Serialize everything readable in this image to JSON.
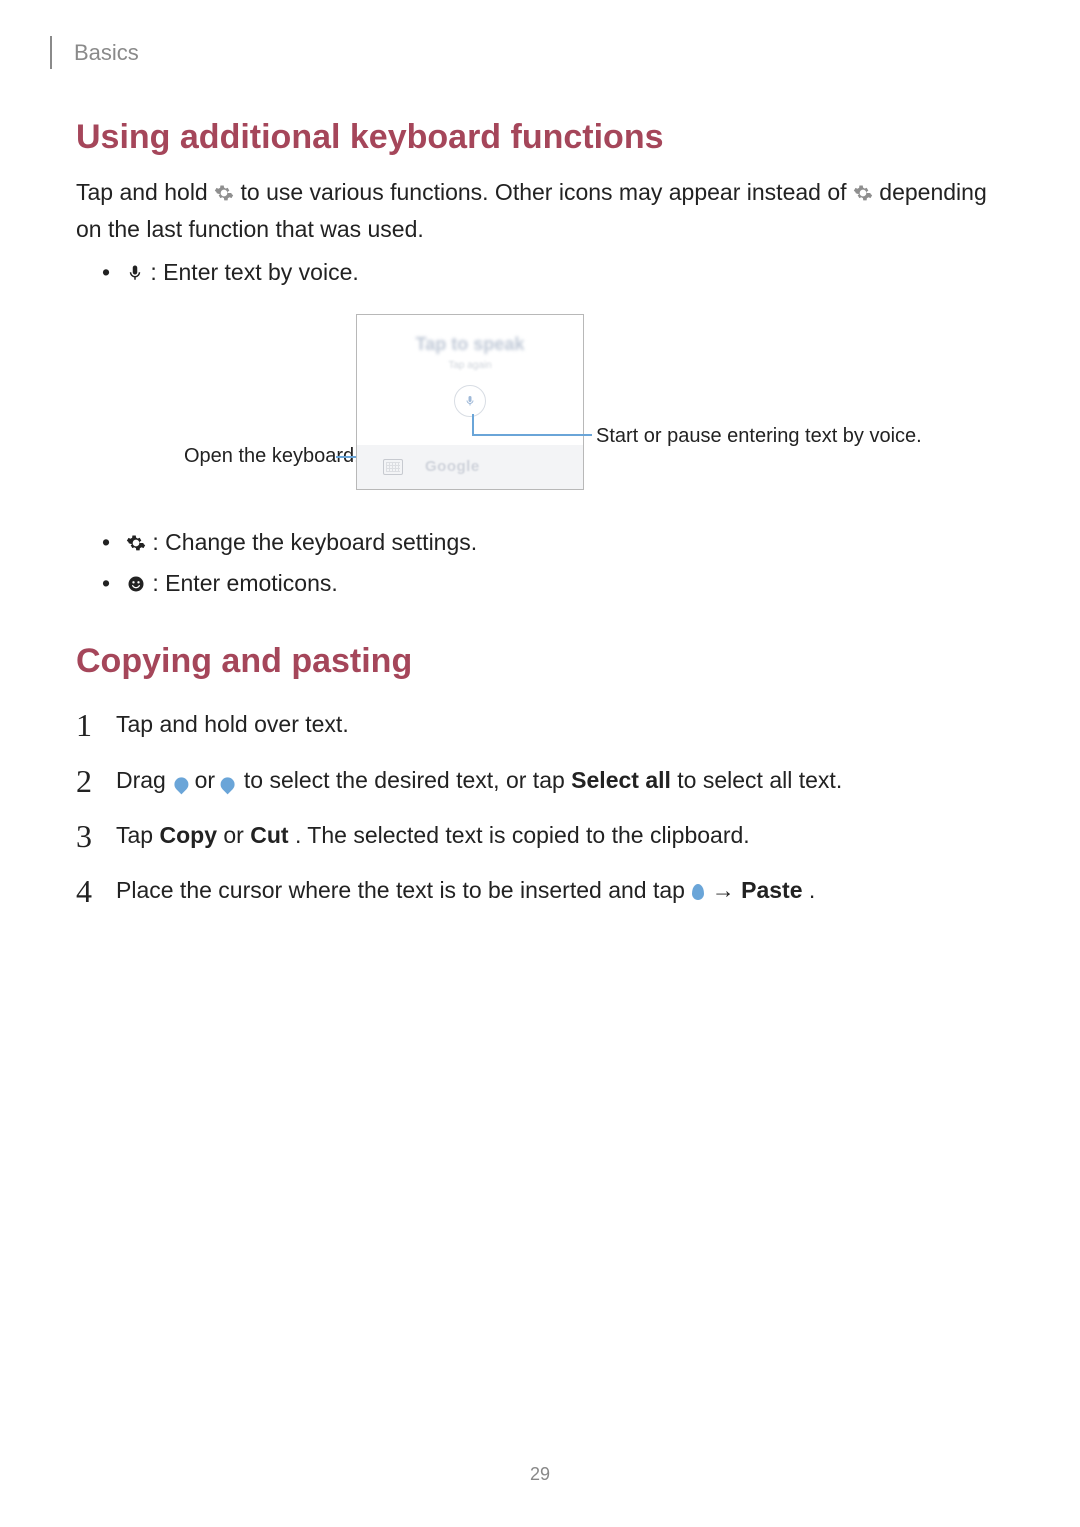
{
  "header": {
    "section": "Basics"
  },
  "h1": "Using additional keyboard functions",
  "intro": {
    "p1a": "Tap and hold ",
    "p1b": " to use various functions. Other icons may appear instead of ",
    "p1c": " depending on the last function that was used."
  },
  "bullets1": {
    "voice": " : Enter text by voice."
  },
  "diagram": {
    "tap_to_speak": "Tap to speak",
    "sub": "Tap again",
    "google": "Google",
    "callout_left": "Open the keyboard.",
    "callout_right": "Start or pause entering text by voice."
  },
  "bullets2": {
    "settings": " : Change the keyboard settings.",
    "emoticons": " : Enter emoticons."
  },
  "h2": "Copying and pasting",
  "steps": {
    "s1": "Tap and hold over text.",
    "s2a": "Drag ",
    "s2b": " or ",
    "s2c": " to select the desired text, or tap ",
    "s2_selectall": "Select all",
    "s2d": " to select all text.",
    "s3a": "Tap ",
    "s3_copy": "Copy",
    "s3b": " or ",
    "s3_cut": "Cut",
    "s3c": ". The selected text is copied to the clipboard.",
    "s4a": "Place the cursor where the text is to be inserted and tap ",
    "s4_arrow": " → ",
    "s4_paste": "Paste",
    "s4b": "."
  },
  "page_number": "29",
  "colors": {
    "accent": "#a5465a",
    "callout_line": "#6aa5d8"
  }
}
